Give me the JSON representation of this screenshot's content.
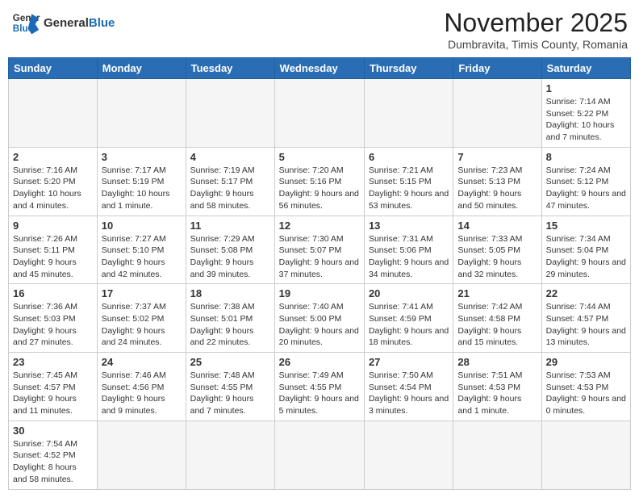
{
  "header": {
    "logo_general": "General",
    "logo_blue": "Blue",
    "month_title": "November 2025",
    "location": "Dumbravita, Timis County, Romania"
  },
  "days_of_week": [
    "Sunday",
    "Monday",
    "Tuesday",
    "Wednesday",
    "Thursday",
    "Friday",
    "Saturday"
  ],
  "weeks": [
    [
      {
        "day": "",
        "info": ""
      },
      {
        "day": "",
        "info": ""
      },
      {
        "day": "",
        "info": ""
      },
      {
        "day": "",
        "info": ""
      },
      {
        "day": "",
        "info": ""
      },
      {
        "day": "",
        "info": ""
      },
      {
        "day": "1",
        "info": "Sunrise: 7:14 AM\nSunset: 5:22 PM\nDaylight: 10 hours and 7 minutes."
      }
    ],
    [
      {
        "day": "2",
        "info": "Sunrise: 7:16 AM\nSunset: 5:20 PM\nDaylight: 10 hours and 4 minutes."
      },
      {
        "day": "3",
        "info": "Sunrise: 7:17 AM\nSunset: 5:19 PM\nDaylight: 10 hours and 1 minute."
      },
      {
        "day": "4",
        "info": "Sunrise: 7:19 AM\nSunset: 5:17 PM\nDaylight: 9 hours and 58 minutes."
      },
      {
        "day": "5",
        "info": "Sunrise: 7:20 AM\nSunset: 5:16 PM\nDaylight: 9 hours and 56 minutes."
      },
      {
        "day": "6",
        "info": "Sunrise: 7:21 AM\nSunset: 5:15 PM\nDaylight: 9 hours and 53 minutes."
      },
      {
        "day": "7",
        "info": "Sunrise: 7:23 AM\nSunset: 5:13 PM\nDaylight: 9 hours and 50 minutes."
      },
      {
        "day": "8",
        "info": "Sunrise: 7:24 AM\nSunset: 5:12 PM\nDaylight: 9 hours and 47 minutes."
      }
    ],
    [
      {
        "day": "9",
        "info": "Sunrise: 7:26 AM\nSunset: 5:11 PM\nDaylight: 9 hours and 45 minutes."
      },
      {
        "day": "10",
        "info": "Sunrise: 7:27 AM\nSunset: 5:10 PM\nDaylight: 9 hours and 42 minutes."
      },
      {
        "day": "11",
        "info": "Sunrise: 7:29 AM\nSunset: 5:08 PM\nDaylight: 9 hours and 39 minutes."
      },
      {
        "day": "12",
        "info": "Sunrise: 7:30 AM\nSunset: 5:07 PM\nDaylight: 9 hours and 37 minutes."
      },
      {
        "day": "13",
        "info": "Sunrise: 7:31 AM\nSunset: 5:06 PM\nDaylight: 9 hours and 34 minutes."
      },
      {
        "day": "14",
        "info": "Sunrise: 7:33 AM\nSunset: 5:05 PM\nDaylight: 9 hours and 32 minutes."
      },
      {
        "day": "15",
        "info": "Sunrise: 7:34 AM\nSunset: 5:04 PM\nDaylight: 9 hours and 29 minutes."
      }
    ],
    [
      {
        "day": "16",
        "info": "Sunrise: 7:36 AM\nSunset: 5:03 PM\nDaylight: 9 hours and 27 minutes."
      },
      {
        "day": "17",
        "info": "Sunrise: 7:37 AM\nSunset: 5:02 PM\nDaylight: 9 hours and 24 minutes."
      },
      {
        "day": "18",
        "info": "Sunrise: 7:38 AM\nSunset: 5:01 PM\nDaylight: 9 hours and 22 minutes."
      },
      {
        "day": "19",
        "info": "Sunrise: 7:40 AM\nSunset: 5:00 PM\nDaylight: 9 hours and 20 minutes."
      },
      {
        "day": "20",
        "info": "Sunrise: 7:41 AM\nSunset: 4:59 PM\nDaylight: 9 hours and 18 minutes."
      },
      {
        "day": "21",
        "info": "Sunrise: 7:42 AM\nSunset: 4:58 PM\nDaylight: 9 hours and 15 minutes."
      },
      {
        "day": "22",
        "info": "Sunrise: 7:44 AM\nSunset: 4:57 PM\nDaylight: 9 hours and 13 minutes."
      }
    ],
    [
      {
        "day": "23",
        "info": "Sunrise: 7:45 AM\nSunset: 4:57 PM\nDaylight: 9 hours and 11 minutes."
      },
      {
        "day": "24",
        "info": "Sunrise: 7:46 AM\nSunset: 4:56 PM\nDaylight: 9 hours and 9 minutes."
      },
      {
        "day": "25",
        "info": "Sunrise: 7:48 AM\nSunset: 4:55 PM\nDaylight: 9 hours and 7 minutes."
      },
      {
        "day": "26",
        "info": "Sunrise: 7:49 AM\nSunset: 4:55 PM\nDaylight: 9 hours and 5 minutes."
      },
      {
        "day": "27",
        "info": "Sunrise: 7:50 AM\nSunset: 4:54 PM\nDaylight: 9 hours and 3 minutes."
      },
      {
        "day": "28",
        "info": "Sunrise: 7:51 AM\nSunset: 4:53 PM\nDaylight: 9 hours and 1 minute."
      },
      {
        "day": "29",
        "info": "Sunrise: 7:53 AM\nSunset: 4:53 PM\nDaylight: 9 hours and 0 minutes."
      }
    ],
    [
      {
        "day": "30",
        "info": "Sunrise: 7:54 AM\nSunset: 4:52 PM\nDaylight: 8 hours and 58 minutes."
      },
      {
        "day": "",
        "info": ""
      },
      {
        "day": "",
        "info": ""
      },
      {
        "day": "",
        "info": ""
      },
      {
        "day": "",
        "info": ""
      },
      {
        "day": "",
        "info": ""
      },
      {
        "day": "",
        "info": ""
      }
    ]
  ]
}
